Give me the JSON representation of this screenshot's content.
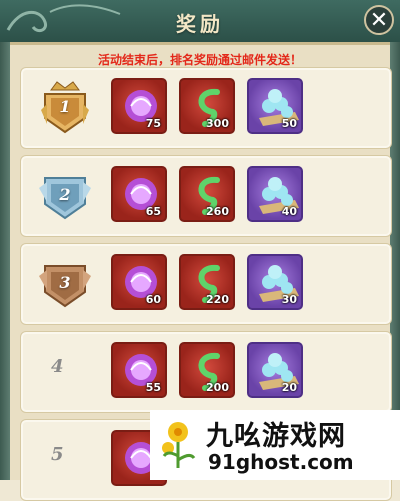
{
  "window": {
    "title": "奖励",
    "close_icon": "close-icon"
  },
  "notice": "活动结束后，排名奖励通过邮件发送！",
  "colors": {
    "notice": "#e3281a",
    "header": "#2c5048",
    "row_bg": "#f5f0e0"
  },
  "rows": [
    {
      "rank": "1",
      "badge": "gold-crown-badge",
      "items": [
        {
          "icon": "purple-orb-icon",
          "count": "75"
        },
        {
          "icon": "green-leaf-icon",
          "count": "300"
        },
        {
          "icon": "blue-pearls-icon",
          "count": "50"
        }
      ]
    },
    {
      "rank": "2",
      "badge": "silver-badge",
      "items": [
        {
          "icon": "purple-orb-icon",
          "count": "65"
        },
        {
          "icon": "green-leaf-icon",
          "count": "260"
        },
        {
          "icon": "blue-pearls-icon",
          "count": "40"
        }
      ]
    },
    {
      "rank": "3",
      "badge": "bronze-badge",
      "items": [
        {
          "icon": "purple-orb-icon",
          "count": "60"
        },
        {
          "icon": "green-leaf-icon",
          "count": "220"
        },
        {
          "icon": "blue-pearls-icon",
          "count": "30"
        }
      ]
    },
    {
      "rank": "4",
      "badge": "",
      "items": [
        {
          "icon": "purple-orb-icon",
          "count": "55"
        },
        {
          "icon": "green-leaf-icon",
          "count": "200"
        },
        {
          "icon": "blue-pearls-icon",
          "count": "20"
        }
      ]
    },
    {
      "rank": "5",
      "badge": "",
      "items": [
        {
          "icon": "purple-orb-icon",
          "count": ""
        }
      ]
    }
  ],
  "watermark": {
    "name": "九吆游戏网",
    "url": "91ghost.com"
  }
}
